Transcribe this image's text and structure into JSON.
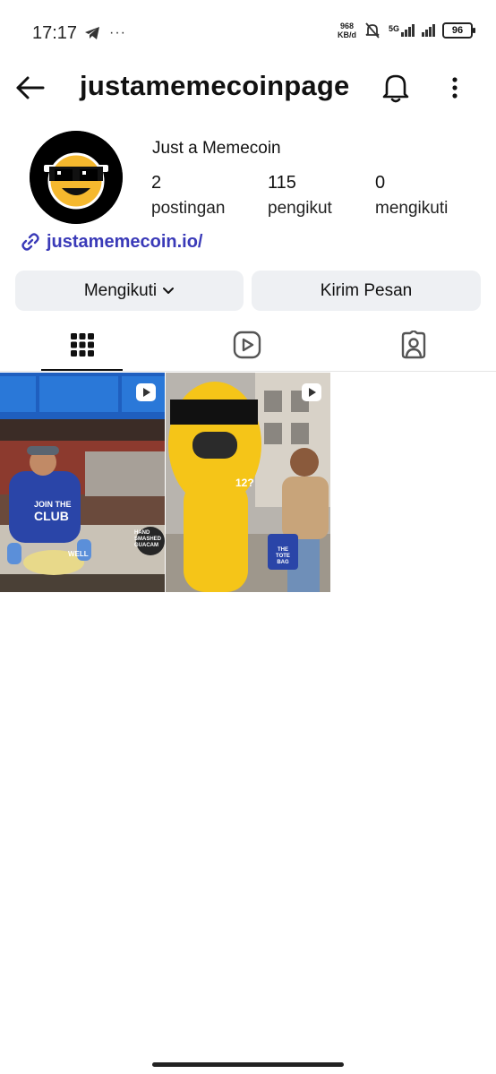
{
  "status_bar": {
    "time": "17:17",
    "net_speed_value": "968",
    "net_speed_unit": "KB/d",
    "network_type": "5G",
    "battery": "96"
  },
  "profile": {
    "username": "justamemecoinpage",
    "display_name": "Just a Memecoin",
    "stats": [
      {
        "value": "2",
        "label": "postingan"
      },
      {
        "value": "115",
        "label": "pengikut"
      },
      {
        "value": "0",
        "label": "mengikuti"
      }
    ],
    "link": "justamemecoin.io/"
  },
  "actions": {
    "follow_label": "Mengikuti",
    "message_label": "Kirim Pesan"
  },
  "tabs": [
    "posts-grid",
    "reels",
    "tagged"
  ],
  "posts": [
    {
      "type": "reel",
      "overlay_texts": [
        "JOIN THE",
        "CLUB",
        "HAND SMASHED GUACAM",
        "WELL"
      ]
    },
    {
      "type": "reel",
      "overlay_texts": [
        "12?",
        "THE TOTE BAG"
      ]
    }
  ],
  "colors": {
    "link": "#3a3ab8",
    "button_bg": "#eef0f3",
    "accent_yellow": "#f5c518"
  }
}
